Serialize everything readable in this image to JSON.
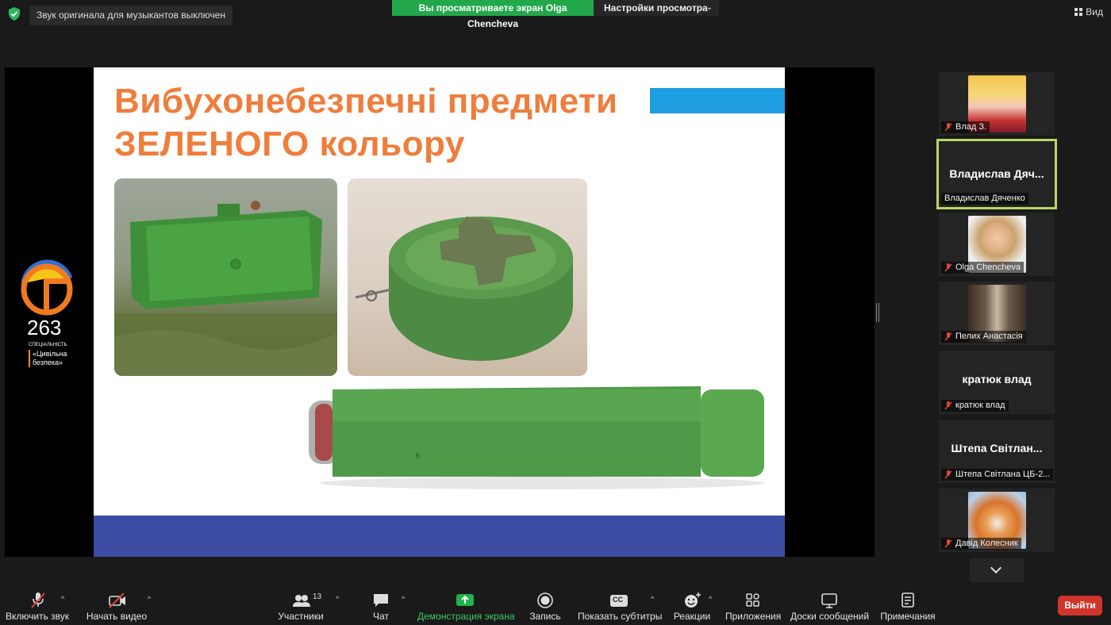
{
  "top": {
    "notice": "Звук оригинала для музыкантов выключен",
    "share_banner": "Вы просматриваете экран Olga Chencheva",
    "view_settings": "Настройки просмотра",
    "view_button": "Вид"
  },
  "slide": {
    "title_line1": "Вибухонебезпечні предмети",
    "title_line2": "ЗЕЛЕНОГО кольору",
    "logo_number": "263",
    "logo_caption_small": "СПЕЦІАЛЬНІСТЬ",
    "logo_caption": "«Цивільна безпека»",
    "colors": {
      "title": "#ef7d3b",
      "blue_tab": "#1e9de0",
      "bottom_band": "#3c4da3"
    }
  },
  "participants": [
    {
      "name": "Влад З.",
      "display": "",
      "muted": true,
      "has_photo": true
    },
    {
      "name": "Владислав Дяченко",
      "display": "Владислав Дяч...",
      "muted": false,
      "has_photo": false,
      "active": true
    },
    {
      "name": "Olga Chencheva",
      "display": "",
      "muted": true,
      "has_photo": true
    },
    {
      "name": "Пелих Анастасія",
      "display": "",
      "muted": true,
      "has_photo": true
    },
    {
      "name": "кратюк влад",
      "display": "кратюк влад",
      "muted": true,
      "has_photo": false
    },
    {
      "name": "Штепа Світлана ЦБ-2...",
      "display": "Штепа Світлан...",
      "muted": true,
      "has_photo": false
    },
    {
      "name": "Давід Колесник",
      "display": "",
      "muted": true,
      "has_photo": true
    }
  ],
  "toolbar": {
    "unmute": "Включить звук",
    "start_video": "Начать видео",
    "participants": "Участники",
    "participants_count": "13",
    "chat": "Чат",
    "share_screen": "Демонстрация экрана",
    "record": "Запись",
    "captions": "Показать субтитры",
    "captions_icon_text": "CC",
    "reactions": "Реакции",
    "apps": "Приложения",
    "whiteboards": "Доски сообщений",
    "notes": "Примечания",
    "exit": "Выйти"
  }
}
